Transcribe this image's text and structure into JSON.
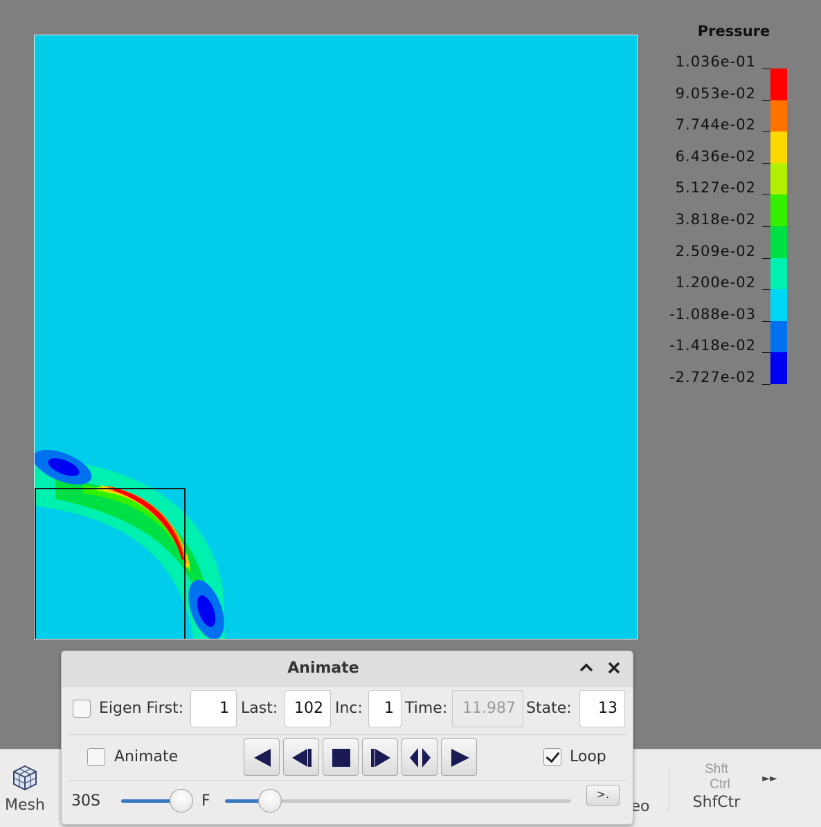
{
  "legend": {
    "title": "Pressure",
    "labels": [
      "1.036e-01",
      "9.053e-02",
      "7.744e-02",
      "6.436e-02",
      "5.127e-02",
      "3.818e-02",
      "2.509e-02",
      "1.200e-02",
      "-1.088e-03",
      "-1.418e-02",
      "-2.727e-02"
    ],
    "colors": [
      "#ff0000",
      "#ff7200",
      "#ffd800",
      "#b0f000",
      "#34f000",
      "#00e044",
      "#00f0b0",
      "#00d6f5",
      "#0072f0",
      "#0000f2"
    ]
  },
  "toolbar": {
    "mesh_label": "Mesh",
    "partial_label": "eo",
    "shift_label": "Shft",
    "ctrl_label": "Ctrl",
    "shfctr_label": "ShfCtr"
  },
  "dialog": {
    "title": "Animate",
    "eigen_label": "Eigen First:",
    "eigen_checked": false,
    "first_value": "1",
    "last_label": "Last:",
    "last_value": "102",
    "inc_label": "Inc:",
    "inc_value": "1",
    "time_label": "Time:",
    "time_value": "11.987",
    "state_label": "State:",
    "state_value": "13",
    "animate_label": "Animate",
    "animate_checked": false,
    "loop_label": "Loop",
    "loop_checked": true,
    "speed_left_label": "30S",
    "speed_right_label": "F",
    "speed_value": 0.84,
    "state_slider_value": 0.13,
    "extra_button_label": ">."
  }
}
